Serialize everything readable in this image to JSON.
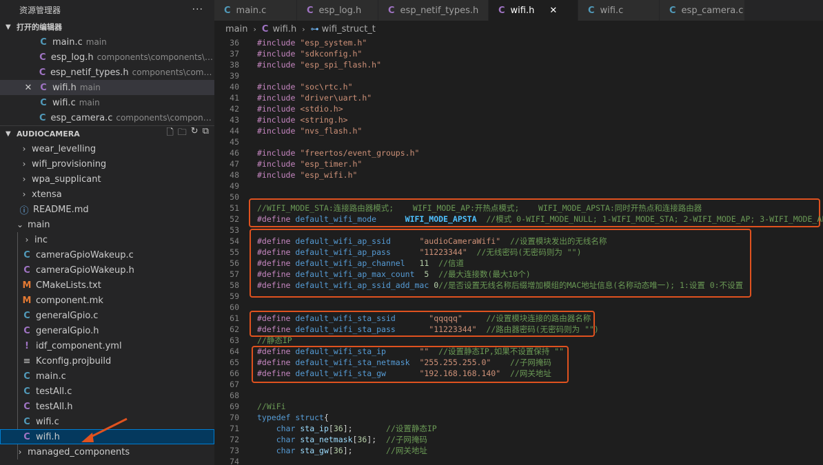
{
  "sidebar": {
    "title": "资源管理器",
    "more": "···",
    "open_editors": {
      "label": "打开的编辑器",
      "items": [
        {
          "icon": "C",
          "name": "main.c",
          "desc": "main"
        },
        {
          "icon": "C",
          "name": "esp_log.h",
          "desc": "components\\components\\log\\in..."
        },
        {
          "icon": "C",
          "name": "esp_netif_types.h",
          "desc": "components\\componen..."
        },
        {
          "icon": "C",
          "name": "wifi.h",
          "desc": "main"
        },
        {
          "icon": "C",
          "name": "wifi.c",
          "desc": "main"
        },
        {
          "icon": "C",
          "name": "esp_camera.c",
          "desc": "components\\components\\c..."
        }
      ]
    },
    "project": {
      "label": "AUDIOCAMERA",
      "items": [
        {
          "chev": "›",
          "name": "wear_levelling"
        },
        {
          "chev": "›",
          "name": "wifi_provisioning"
        },
        {
          "chev": "›",
          "name": "wpa_supplicant"
        },
        {
          "chev": "›",
          "name": "xtensa"
        },
        {
          "icon": "ⓘ",
          "name": "README.md"
        },
        {
          "chev": "⌄",
          "name": "main"
        },
        {
          "chev": "›",
          "name": "inc"
        },
        {
          "icon": "C",
          "name": "cameraGpioWakeup.c"
        },
        {
          "icon": "C",
          "name": "cameraGpioWakeup.h"
        },
        {
          "icon": "M",
          "name": "CMakeLists.txt"
        },
        {
          "icon": "M",
          "name": "component.mk"
        },
        {
          "icon": "C",
          "name": "generalGpio.c"
        },
        {
          "icon": "C",
          "name": "generalGpio.h"
        },
        {
          "icon": "!",
          "name": "idf_component.yml"
        },
        {
          "icon": "≡",
          "name": "Kconfig.projbuild"
        },
        {
          "icon": "C",
          "name": "main.c"
        },
        {
          "icon": "C",
          "name": "testAll.c"
        },
        {
          "icon": "C",
          "name": "testAll.h"
        },
        {
          "icon": "C",
          "name": "wifi.c"
        },
        {
          "icon": "C",
          "name": "wifi.h"
        },
        {
          "chev": "›",
          "name": "managed_components"
        }
      ]
    }
  },
  "tabs": [
    {
      "icon": "C",
      "label": "main.c"
    },
    {
      "icon": "C",
      "label": "esp_log.h"
    },
    {
      "icon": "C",
      "label": "esp_netif_types.h"
    },
    {
      "icon": "C",
      "label": "wifi.h",
      "close": "✕"
    },
    {
      "icon": "C",
      "label": "wifi.c"
    },
    {
      "icon": "C",
      "label": "esp_camera.c"
    }
  ],
  "breadcrumb": {
    "folder": "main",
    "file_icon": "C",
    "file": "wifi.h",
    "symbol_icon": "⊶",
    "symbol": "wifi_struct_t"
  },
  "code_lines": [
    {
      "n": "36",
      "t": "#include \"esp_system.h\""
    },
    {
      "n": "37",
      "t": "#include \"sdkconfig.h\""
    },
    {
      "n": "38",
      "t": "#include \"esp_spi_flash.h\""
    },
    {
      "n": "39",
      "t": ""
    },
    {
      "n": "40",
      "t": "#include \"soc\\rtc.h\""
    },
    {
      "n": "41",
      "t": "#include \"driver\\uart.h\""
    },
    {
      "n": "42",
      "t": "#include <stdio.h>"
    },
    {
      "n": "43",
      "t": "#include <string.h>"
    },
    {
      "n": "44",
      "t": "#include \"nvs_flash.h\""
    },
    {
      "n": "45",
      "t": ""
    },
    {
      "n": "46",
      "t": "#include \"freertos/event_groups.h\""
    },
    {
      "n": "47",
      "t": "#include \"esp_timer.h\""
    },
    {
      "n": "48",
      "t": "#include \"esp_wifi.h\""
    },
    {
      "n": "49",
      "t": ""
    },
    {
      "n": "50",
      "t": ""
    },
    {
      "n": "51",
      "t": "//WIFI_MODE_STA:连接路由器模式;    WIFI_MODE_AP:开热点模式;    WIFI_MODE_APSTA:同时开热点和连接路由器"
    },
    {
      "n": "52",
      "t": "#define default_wifi_mode      WIFI_MODE_APSTA  //模式 0-WIFI_MODE_NULL; 1-WIFI_MODE_STA; 2-WIFI_MODE_AP; 3-WIFI_MODE_APSTA"
    },
    {
      "n": "53",
      "t": ""
    },
    {
      "n": "54",
      "t": "#define default_wifi_ap_ssid      \"audioCameraWifi\"  //设置模块发出的无线名称"
    },
    {
      "n": "55",
      "t": "#define default_wifi_ap_pass      \"11223344\"  //无线密码(无密码则为 \"\")"
    },
    {
      "n": "56",
      "t": "#define default_wifi_ap_channel   11  //信道"
    },
    {
      "n": "57",
      "t": "#define default_wifi_ap_max_count  5  //最大连接数(最大10个)"
    },
    {
      "n": "58",
      "t": "#define default_wifi_ap_ssid_add_mac 0//是否设置无线名称后缀增加模组的MAC地址信息(名称动态唯一); 1:设置 0:不设置"
    },
    {
      "n": "59",
      "t": ""
    },
    {
      "n": "60",
      "t": ""
    },
    {
      "n": "61",
      "t": "#define default_wifi_sta_ssid       \"qqqqq\"     //设置模块连接的路由器名称"
    },
    {
      "n": "62",
      "t": "#define default_wifi_sta_pass       \"11223344\"  //路由器密码(无密码则为 \"\")"
    },
    {
      "n": "63",
      "t": "//静态IP"
    },
    {
      "n": "64",
      "t": "#define default_wifi_sta_ip       \"\"  //设置静态IP,如果不设置保持 \"\""
    },
    {
      "n": "65",
      "t": "#define default_wifi_sta_netmask  \"255.255.255.0\"    //子网掩码"
    },
    {
      "n": "66",
      "t": "#define default_wifi_sta_gw       \"192.168.168.140\"  //网关地址"
    },
    {
      "n": "67",
      "t": ""
    },
    {
      "n": "68",
      "t": ""
    },
    {
      "n": "69",
      "t": "//WiFi"
    },
    {
      "n": "70",
      "t": "typedef struct{"
    },
    {
      "n": "71",
      "t": "    char sta_ip[36];       //设置静态IP"
    },
    {
      "n": "72",
      "t": "    char sta_netmask[36];  //子网掩码"
    },
    {
      "n": "73",
      "t": "    char sta_gw[36];       //网关地址"
    },
    {
      "n": "74",
      "t": ""
    }
  ],
  "colors": {
    "highlight": "#e0521f",
    "selection": "#04395e",
    "accent": "#007fd4"
  }
}
